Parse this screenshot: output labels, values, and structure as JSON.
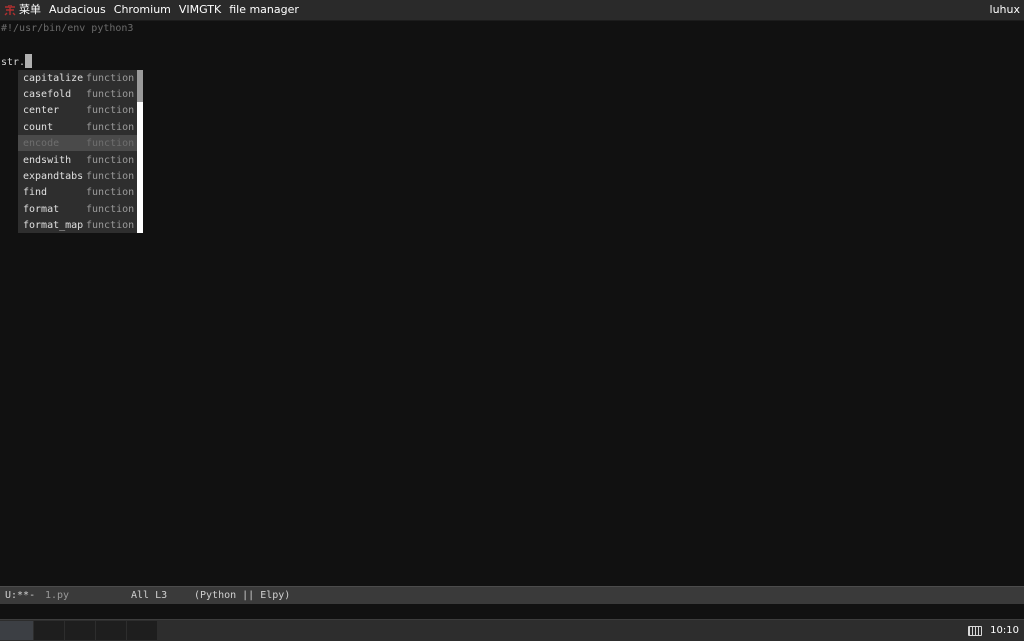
{
  "menubar": {
    "logo_icon": "distro-logo-icon",
    "items": [
      "菜单",
      "Audacious",
      "Chromium",
      "VIMGTK",
      "file manager"
    ],
    "user": "luhux"
  },
  "editor": {
    "lines": [
      "#!/usr/bin/env python3",
      "",
      "str."
    ]
  },
  "completion": {
    "items": [
      {
        "name": "capitalize",
        "kind": "function"
      },
      {
        "name": "casefold",
        "kind": "function"
      },
      {
        "name": "center",
        "kind": "function"
      },
      {
        "name": "count",
        "kind": "function"
      },
      {
        "name": "encode",
        "kind": "function",
        "selected": true
      },
      {
        "name": "endswith",
        "kind": "function"
      },
      {
        "name": "expandtabs",
        "kind": "function"
      },
      {
        "name": "find",
        "kind": "function"
      },
      {
        "name": "format",
        "kind": "function"
      },
      {
        "name": "format_map",
        "kind": "function"
      }
    ],
    "selected_index": 4
  },
  "modeline": {
    "status": "U:**-",
    "filename": "1.py",
    "position": "All L3",
    "mode": "(Python || Elpy)"
  },
  "taskbar": {
    "workspaces": 5,
    "active_workspace": 0,
    "clock": "10:10"
  },
  "colors": {
    "background": "#111111",
    "menubar": "#2a2a2a",
    "modeline": "#3a3a3a",
    "popup": "#2e2e2e",
    "popup_selected": "#4a4a4a",
    "logo": "#c0392b"
  }
}
